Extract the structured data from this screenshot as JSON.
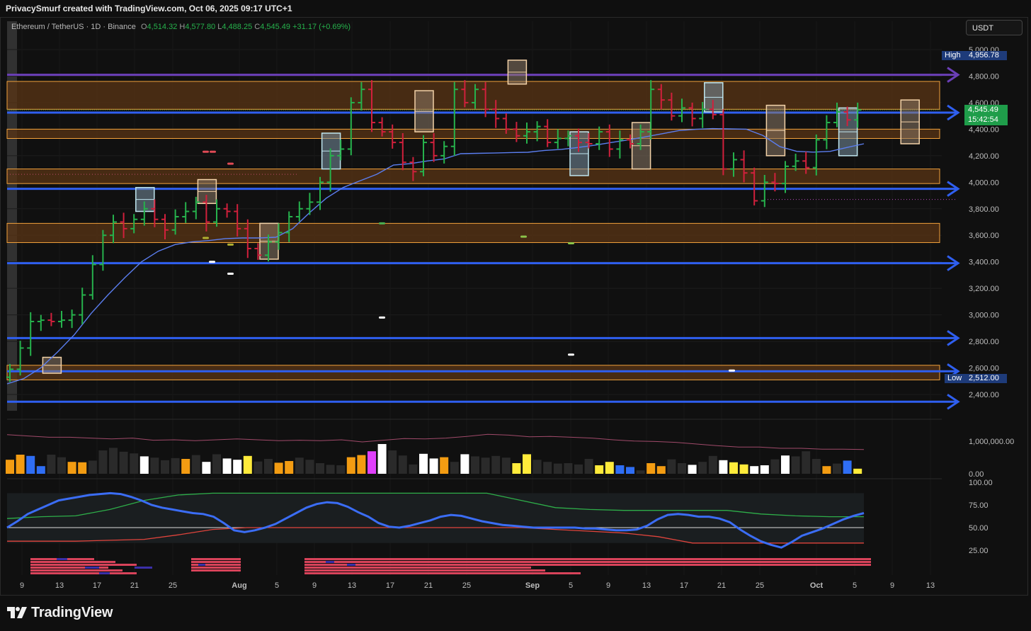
{
  "header": {
    "attribution": "PrivacySmurf created with TradingView.com, Oct 06, 2025 09:17 UTC+1",
    "currency_button": "USDT"
  },
  "legend": {
    "symbol": "Ethereum / TetherUS · 1D · Binance",
    "open_key": "O",
    "open": "4,514.32",
    "high_key": "H",
    "high": "4,577.80",
    "low_key": "L",
    "low": "4,488.25",
    "close_key": "C",
    "close": "4,545.49",
    "change": "+31.17 (+0.69%)"
  },
  "price_tags": {
    "high_label": "High",
    "high_value": "4,956.78",
    "current_price": "4,545.49",
    "countdown": "15:42:54",
    "low_label": "Low",
    "low_value": "2,512.00"
  },
  "footer": {
    "brand": "TradingView"
  },
  "colors": {
    "up": "#26b24c",
    "down": "#d1203c",
    "zone_fill": "#5a3414",
    "zone_border": "#f2a23c",
    "level_line": "#2f5ff0",
    "resistance": "#6b3fb8",
    "ma": "#5b7ef0",
    "rsi": "#3b6df5",
    "rsi_upper": "#2eae49",
    "rsi_lower": "#e0443c"
  },
  "chart_data": [
    {
      "type": "candlestick",
      "price_axis": [
        "5,000.00",
        "4,800.00",
        "4,600.00",
        "4,400.00",
        "4,200.00",
        "4,000.00",
        "3,800.00",
        "3,600.00",
        "3,400.00",
        "3,200.00",
        "3,000.00",
        "2,800.00",
        "2,600.00",
        "2,400.00"
      ],
      "x_axis": [
        "9",
        "13",
        "17",
        "21",
        "25",
        "Aug",
        "5",
        "9",
        "13",
        "17",
        "21",
        "25",
        "Sep",
        "5",
        "9",
        "13",
        "17",
        "21",
        "25",
        "Oct",
        "5",
        "9",
        "13"
      ],
      "ylim": [
        2380,
        5060
      ],
      "key_levels": [
        4800,
        4525,
        3950,
        3390,
        2825,
        2575,
        2345
      ],
      "resistance_level": 4810,
      "supply_zones": [
        [
          4550,
          4760
        ],
        [
          4330,
          4400
        ],
        [
          3990,
          4100
        ],
        [
          3545,
          3690
        ],
        [
          2510,
          2620
        ]
      ],
      "close": [
        2590,
        2750,
        2950,
        2960,
        2950,
        2960,
        3000,
        3150,
        3380,
        3600,
        3700,
        3650,
        3720,
        3800,
        3720,
        3640,
        3740,
        3780,
        3850,
        3700,
        3800,
        3780,
        3650,
        3500,
        3450,
        3550,
        3620,
        3740,
        3800,
        3850,
        4000,
        4200,
        4250,
        4600,
        4700,
        4450,
        4380,
        4300,
        4150,
        4080,
        4300,
        4200,
        4270,
        4700,
        4600,
        4700,
        4550,
        4480,
        4400,
        4350,
        4380,
        4420,
        4300,
        4330,
        4350,
        4300,
        4290,
        4380,
        4250,
        4320,
        4290,
        4380,
        4700,
        4620,
        4500,
        4560,
        4480,
        4550,
        4510,
        4100,
        4170,
        4070,
        3860,
        4000,
        3990,
        4120,
        4160,
        4110,
        4320,
        4450,
        4530,
        4470,
        4545
      ],
      "moving_average": [
        2480,
        2520,
        2600,
        2720,
        2850,
        3010,
        3150,
        3280,
        3400,
        3480,
        3530,
        3550,
        3560,
        3575,
        3580,
        3580,
        3585,
        3650,
        3770,
        3880,
        3960,
        4010,
        4060,
        4130,
        4140,
        4160,
        4175,
        4215,
        4218,
        4220,
        4224,
        4226,
        4240,
        4248,
        4262,
        4280,
        4300,
        4320,
        4342,
        4366,
        4390,
        4399,
        4404,
        4402,
        4400,
        4352,
        4268,
        4233,
        4227,
        4233,
        4262,
        4290
      ],
      "volume_axis": [
        "1,000,000.00",
        "0.00"
      ],
      "volume": [
        0.33,
        0.45,
        0.42,
        0.18,
        0.45,
        0.39,
        0.28,
        0.27,
        0.31,
        0.55,
        0.61,
        0.52,
        0.48,
        0.41,
        0.38,
        0.32,
        0.37,
        0.35,
        0.44,
        0.28,
        0.46,
        0.36,
        0.33,
        0.42,
        0.29,
        0.35,
        0.26,
        0.3,
        0.38,
        0.33,
        0.25,
        0.21,
        0.2,
        0.39,
        0.44,
        0.53,
        0.7,
        0.55,
        0.43,
        0.22,
        0.47,
        0.36,
        0.39,
        0.28,
        0.46,
        0.41,
        0.38,
        0.42,
        0.38,
        0.25,
        0.46,
        0.33,
        0.28,
        0.24,
        0.25,
        0.22,
        0.35,
        0.2,
        0.28,
        0.2,
        0.16,
        0.08,
        0.25,
        0.18,
        0.34,
        0.25,
        0.21,
        0.28,
        0.42,
        0.32,
        0.27,
        0.22,
        0.18,
        0.2,
        0.34,
        0.43,
        0.41,
        0.53,
        0.35,
        0.18,
        0.24,
        0.31,
        0.12
      ],
      "volume_ma": [
        0.92,
        0.89,
        0.86,
        0.86,
        0.84,
        0.82,
        0.84,
        0.79,
        0.8,
        0.78,
        0.8,
        0.82,
        0.8,
        0.78,
        0.79,
        0.78,
        0.8,
        0.75,
        0.79,
        0.83,
        0.82,
        0.84,
        0.88,
        0.93,
        0.91,
        0.87,
        0.88,
        0.86,
        0.84,
        0.8,
        0.77,
        0.76,
        0.74,
        0.7,
        0.66,
        0.63,
        0.63,
        0.6,
        0.6,
        0.58,
        0.58,
        0.57
      ],
      "rsi_axis": [
        "100.00",
        "75.00",
        "50.00",
        "25.00"
      ],
      "rsi": [
        50,
        57,
        65,
        70,
        75,
        80,
        82,
        84,
        86,
        87,
        88,
        87,
        84,
        80,
        75,
        72,
        70,
        68,
        66,
        65,
        62,
        55,
        47,
        45,
        47,
        50,
        54,
        60,
        66,
        72,
        76,
        78,
        77,
        73,
        67,
        62,
        55,
        51,
        50,
        52,
        55,
        58,
        62,
        64,
        63,
        60,
        57,
        55,
        53,
        52,
        51,
        50,
        50,
        50,
        50,
        50,
        49,
        49,
        48,
        47,
        47,
        48,
        52,
        59,
        64,
        65,
        64,
        62,
        62,
        60,
        56,
        48,
        41,
        35,
        31,
        28,
        34,
        41,
        45,
        49,
        54,
        59,
        63,
        66
      ]
    }
  ]
}
